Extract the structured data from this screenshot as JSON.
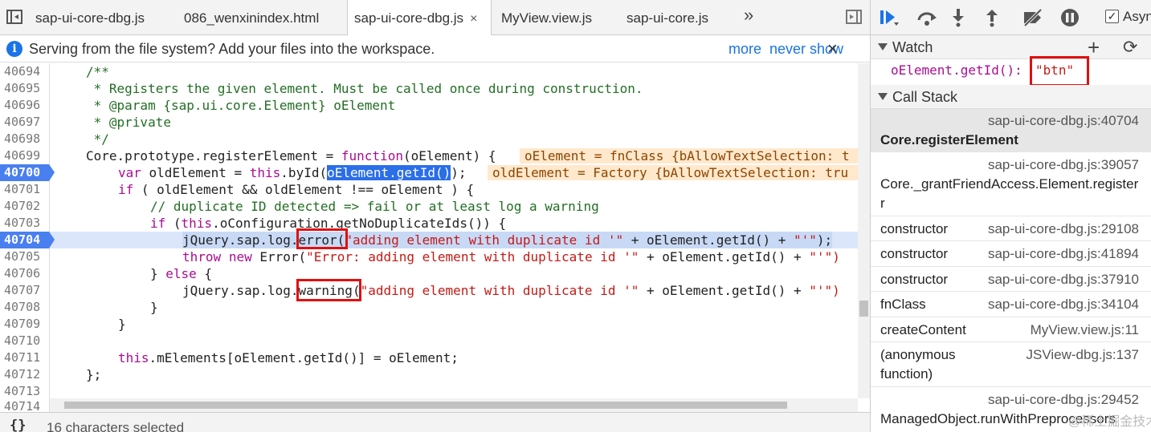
{
  "tabs": [
    {
      "label": "sap-ui-core-dbg.js"
    },
    {
      "label": "086_wenxinindex.html"
    },
    {
      "label": "sap-ui-core-dbg.js",
      "close": "×"
    },
    {
      "label": "MyView.view.js"
    },
    {
      "label": "sap-ui-core.js"
    }
  ],
  "tabs_overflow": "»",
  "infobar": {
    "message": "Serving from the file system? Add your files into the workspace.",
    "more": "more",
    "never_show": "never show",
    "close": "×"
  },
  "code": {
    "lines": [
      {
        "num": "40694"
      },
      {
        "num": "40695"
      },
      {
        "num": "40696"
      },
      {
        "num": "40697"
      },
      {
        "num": "40698"
      },
      {
        "num": "40699"
      },
      {
        "num": "40700"
      },
      {
        "num": "40701"
      },
      {
        "num": "40702"
      },
      {
        "num": "40703"
      },
      {
        "num": "40704"
      },
      {
        "num": "40705"
      },
      {
        "num": "40706"
      },
      {
        "num": "40707"
      },
      {
        "num": "40708"
      },
      {
        "num": "40709"
      },
      {
        "num": "40710"
      },
      {
        "num": "40711"
      },
      {
        "num": "40712"
      },
      {
        "num": "40713"
      },
      {
        "num": "40714"
      }
    ],
    "t": {
      "l0": "/**",
      "l1": " * Registers the given element. Must be called once during construction.",
      "l2": " * @param {sap.ui.core.Element} oElement",
      "l3": " * @private",
      "l4": " */",
      "l5a": "Core.prototype.registerElement = ",
      "l5kw": "function",
      "l5b": "(oElement) {",
      "l5val": "oElement = fnClass {bAllowTextSelection: t",
      "l6kw": "var",
      "l6a": " oldElement = ",
      "l6this": "this",
      "l6b": ".byId(",
      "l6sel": "oElement.getId()",
      "l6c": ");",
      "l6val": "oldElement = Factory {bAllowTextSelection: tru",
      "l7kw": "if",
      "l7a": " ( oldElement && oldElement !== oElement ) {",
      "l8": "// duplicate ID detected => fail or at least log a warning",
      "l9kw": "if",
      "l9a": " (",
      "l9this": "this",
      "l9b": ".oConfiguration.getNoDuplicateIds()) {",
      "l10a": "jQuery.sap.log.",
      "l10b": "error",
      "l10c": "(",
      "l10str": "\"adding element with duplicate id '\"",
      "l10d": " + oElement.getId() + ",
      "l10str2": "\"'\"",
      "l10e": ");",
      "l11kw1": "throw",
      "l11kw2": "new",
      "l11a": " Error(",
      "l11str": "\"Error: adding element with duplicate id '\"",
      "l11b": " + oElement.getId() + ",
      "l11str2": "\"'\")",
      "l12a": "} ",
      "l12kw": "else",
      "l12b": " {",
      "l13a": "jQuery.sap.log.",
      "l13b": "warning",
      "l13c": "(",
      "l13str": "\"adding element with duplicate id '\"",
      "l13d": " + oElement.getId() + ",
      "l13str2": "\"'\")",
      "l14": "}",
      "l15": "}",
      "l17this": "this",
      "l17a": ".mElements[oElement.getId()] = oElement;",
      "l18": "};"
    }
  },
  "status": {
    "braces": "{}",
    "text": "16 characters selected"
  },
  "debugger": {
    "async_label": "Async",
    "async_checked": "✓",
    "watch": {
      "title": "Watch",
      "add": "+",
      "refresh": "⟳",
      "expr": "oElement.getId():",
      "value": "\"btn\""
    },
    "callstack": {
      "title": "Call Stack",
      "frames": [
        {
          "fn": "Core.registerElement",
          "loc": "sap-ui-core-dbg.js:40704"
        },
        {
          "fn": "Core._grantFriendAccess.Element.register",
          "fn2": "r",
          "loc": "sap-ui-core-dbg.js:39057"
        },
        {
          "fn": "constructor",
          "loc": "sap-ui-core-dbg.js:29108"
        },
        {
          "fn": "constructor",
          "loc": "sap-ui-core-dbg.js:41894"
        },
        {
          "fn": "constructor",
          "loc": "sap-ui-core-dbg.js:37910"
        },
        {
          "fn": "fnClass",
          "loc": "sap-ui-core-dbg.js:34104"
        },
        {
          "fn": "createContent",
          "loc": "MyView.view.js:11"
        },
        {
          "fn": "(anonymous",
          "fn2": "function)",
          "loc": "JSView-dbg.js:137"
        },
        {
          "fn": "ManagedObject.runWithPreprocessors",
          "loc": "sap-ui-core-dbg.js:29452"
        }
      ]
    },
    "watermark": "@稀土掘金技术社区"
  }
}
